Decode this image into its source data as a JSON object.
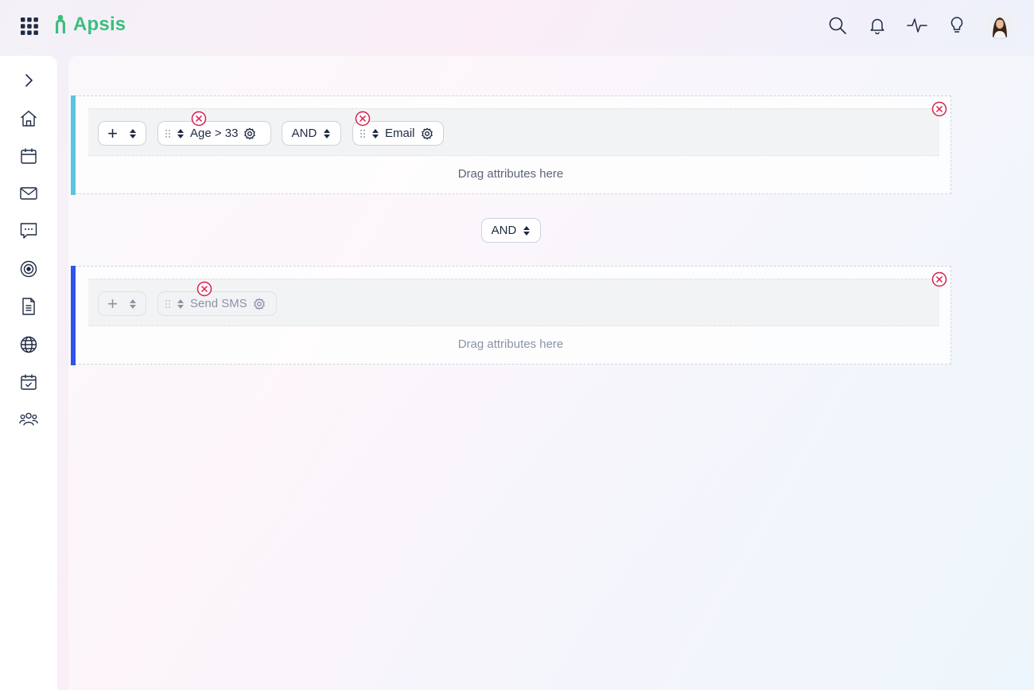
{
  "app": {
    "name": "Apsis",
    "brand_color": "#3dbd7d"
  },
  "topbar": {
    "icons": [
      "search-icon",
      "bell-icon",
      "activity-icon",
      "lightbulb-icon",
      "avatar"
    ]
  },
  "sidebar": {
    "items": [
      {
        "icon": "chevron-right-icon"
      },
      {
        "icon": "home-icon"
      },
      {
        "icon": "calendar-icon"
      },
      {
        "icon": "mail-icon"
      },
      {
        "icon": "chat-icon"
      },
      {
        "icon": "target-icon"
      },
      {
        "icon": "document-icon"
      },
      {
        "icon": "globe-icon"
      },
      {
        "icon": "calendar-check-icon"
      },
      {
        "icon": "users-icon"
      }
    ]
  },
  "groups": [
    {
      "accent_color": "#5bc4e0",
      "add_label": "+",
      "conditions": [
        {
          "label": "Age > 33"
        },
        {
          "operator": "AND"
        },
        {
          "label": "Email"
        }
      ],
      "drag_hint": "Drag attributes here"
    },
    {
      "accent_color": "#2f54eb",
      "add_label": "+",
      "conditions": [
        {
          "label": "Send SMS"
        }
      ],
      "drag_hint": "Drag attributes here"
    }
  ],
  "group_operator": "AND",
  "colors": {
    "remove": "#d6204e",
    "text": "#1f2a44"
  }
}
